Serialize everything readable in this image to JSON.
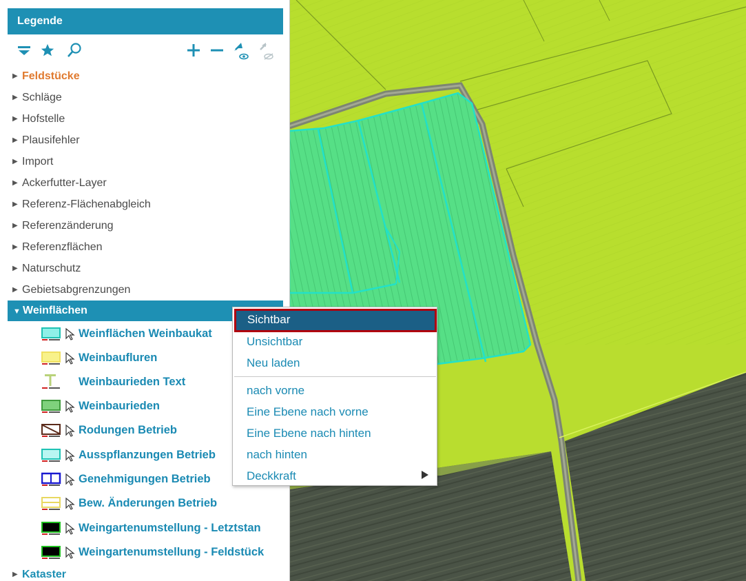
{
  "legend": {
    "title": "Legende",
    "toolbar": {
      "icons": [
        "filter-icon",
        "star-icon",
        "search-icon",
        "plus-icon",
        "minus-icon",
        "visible-eye-icon",
        "invisible-eye-icon"
      ]
    },
    "items": [
      {
        "label": "Feldstücke",
        "active": true
      },
      {
        "label": "Schläge"
      },
      {
        "label": "Hofstelle"
      },
      {
        "label": "Plausifehler"
      },
      {
        "label": "Import"
      },
      {
        "label": "Ackerfutter-Layer"
      },
      {
        "label": "Referenz-Flächenabgleich"
      },
      {
        "label": "Referenzänderung"
      },
      {
        "label": "Referenzflächen"
      },
      {
        "label": "Naturschutz"
      },
      {
        "label": "Gebietsabgrenzungen"
      }
    ],
    "expanded": {
      "label": "Weinflächen",
      "children": [
        {
          "label": "Weinflächen Weinbaukat",
          "symbol": "cyan-box"
        },
        {
          "label": "Weinbaufluren",
          "symbol": "yellow-box"
        },
        {
          "label": "Weinbaurieden Text",
          "symbol": "text-t"
        },
        {
          "label": "Weinbaurieden",
          "symbol": "green-box"
        },
        {
          "label": "Rodungen Betrieb",
          "symbol": "hatched-box"
        },
        {
          "label": "Ausspflanzungen Betrieb",
          "symbol": "cyan-box"
        },
        {
          "label": "Genehmigungen Betrieb",
          "symbol": "blue-box"
        },
        {
          "label": "Bew. Änderungen Betrieb",
          "symbol": "yellow-line-box"
        },
        {
          "label": "Weingartenumstellung - Letztstan",
          "symbol": "black-box"
        },
        {
          "label": "Weingartenumstellung - Feldstück",
          "symbol": "black-box"
        }
      ]
    },
    "after": [
      {
        "label": "Kataster"
      }
    ]
  },
  "context_menu": {
    "selected": "Sichtbar",
    "items": [
      "Unsichtbar",
      "Neu laden"
    ],
    "items2": [
      "nach vorne",
      "Eine Ebene nach vorne",
      "Eine Ebene nach hinten",
      "nach hinten"
    ],
    "submenu": "Deckkraft"
  },
  "colors": {
    "accent": "#1e90b4",
    "active_item": "#e07a2f",
    "menu_selected": "#1b5f86",
    "highlight_border": "#b0000e"
  }
}
